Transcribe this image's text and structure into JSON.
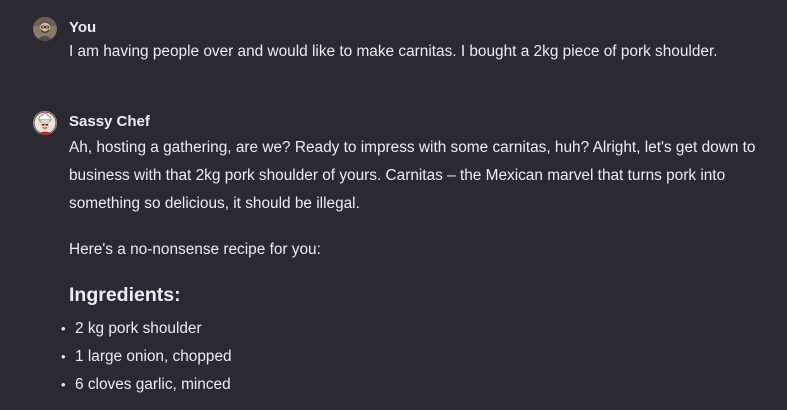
{
  "conversation": {
    "user_message": {
      "author": "You",
      "text": "I am having people over and would like to make carnitas. I bought a 2kg piece of pork shoulder."
    },
    "assistant_message": {
      "author": "Sassy Chef",
      "paragraphs": [
        "Ah, hosting a gathering, are we? Ready to impress with some carnitas, huh? Alright, let's get down to business with that 2kg pork shoulder of yours. Carnitas – the Mexican marvel that turns pork into something so delicious, it should be illegal.",
        "Here's a no-nonsense recipe for you:"
      ],
      "heading": "Ingredients:",
      "ingredients": [
        "2 kg pork shoulder",
        "1 large onion, chopped",
        "6 cloves garlic, minced"
      ],
      "bullet_char": "•"
    }
  },
  "colors": {
    "background": "#2b2a33",
    "text": "#ececf1"
  },
  "icons": {
    "user_avatar": "user-avatar-icon",
    "assistant_avatar": "chef-avatar-icon"
  }
}
